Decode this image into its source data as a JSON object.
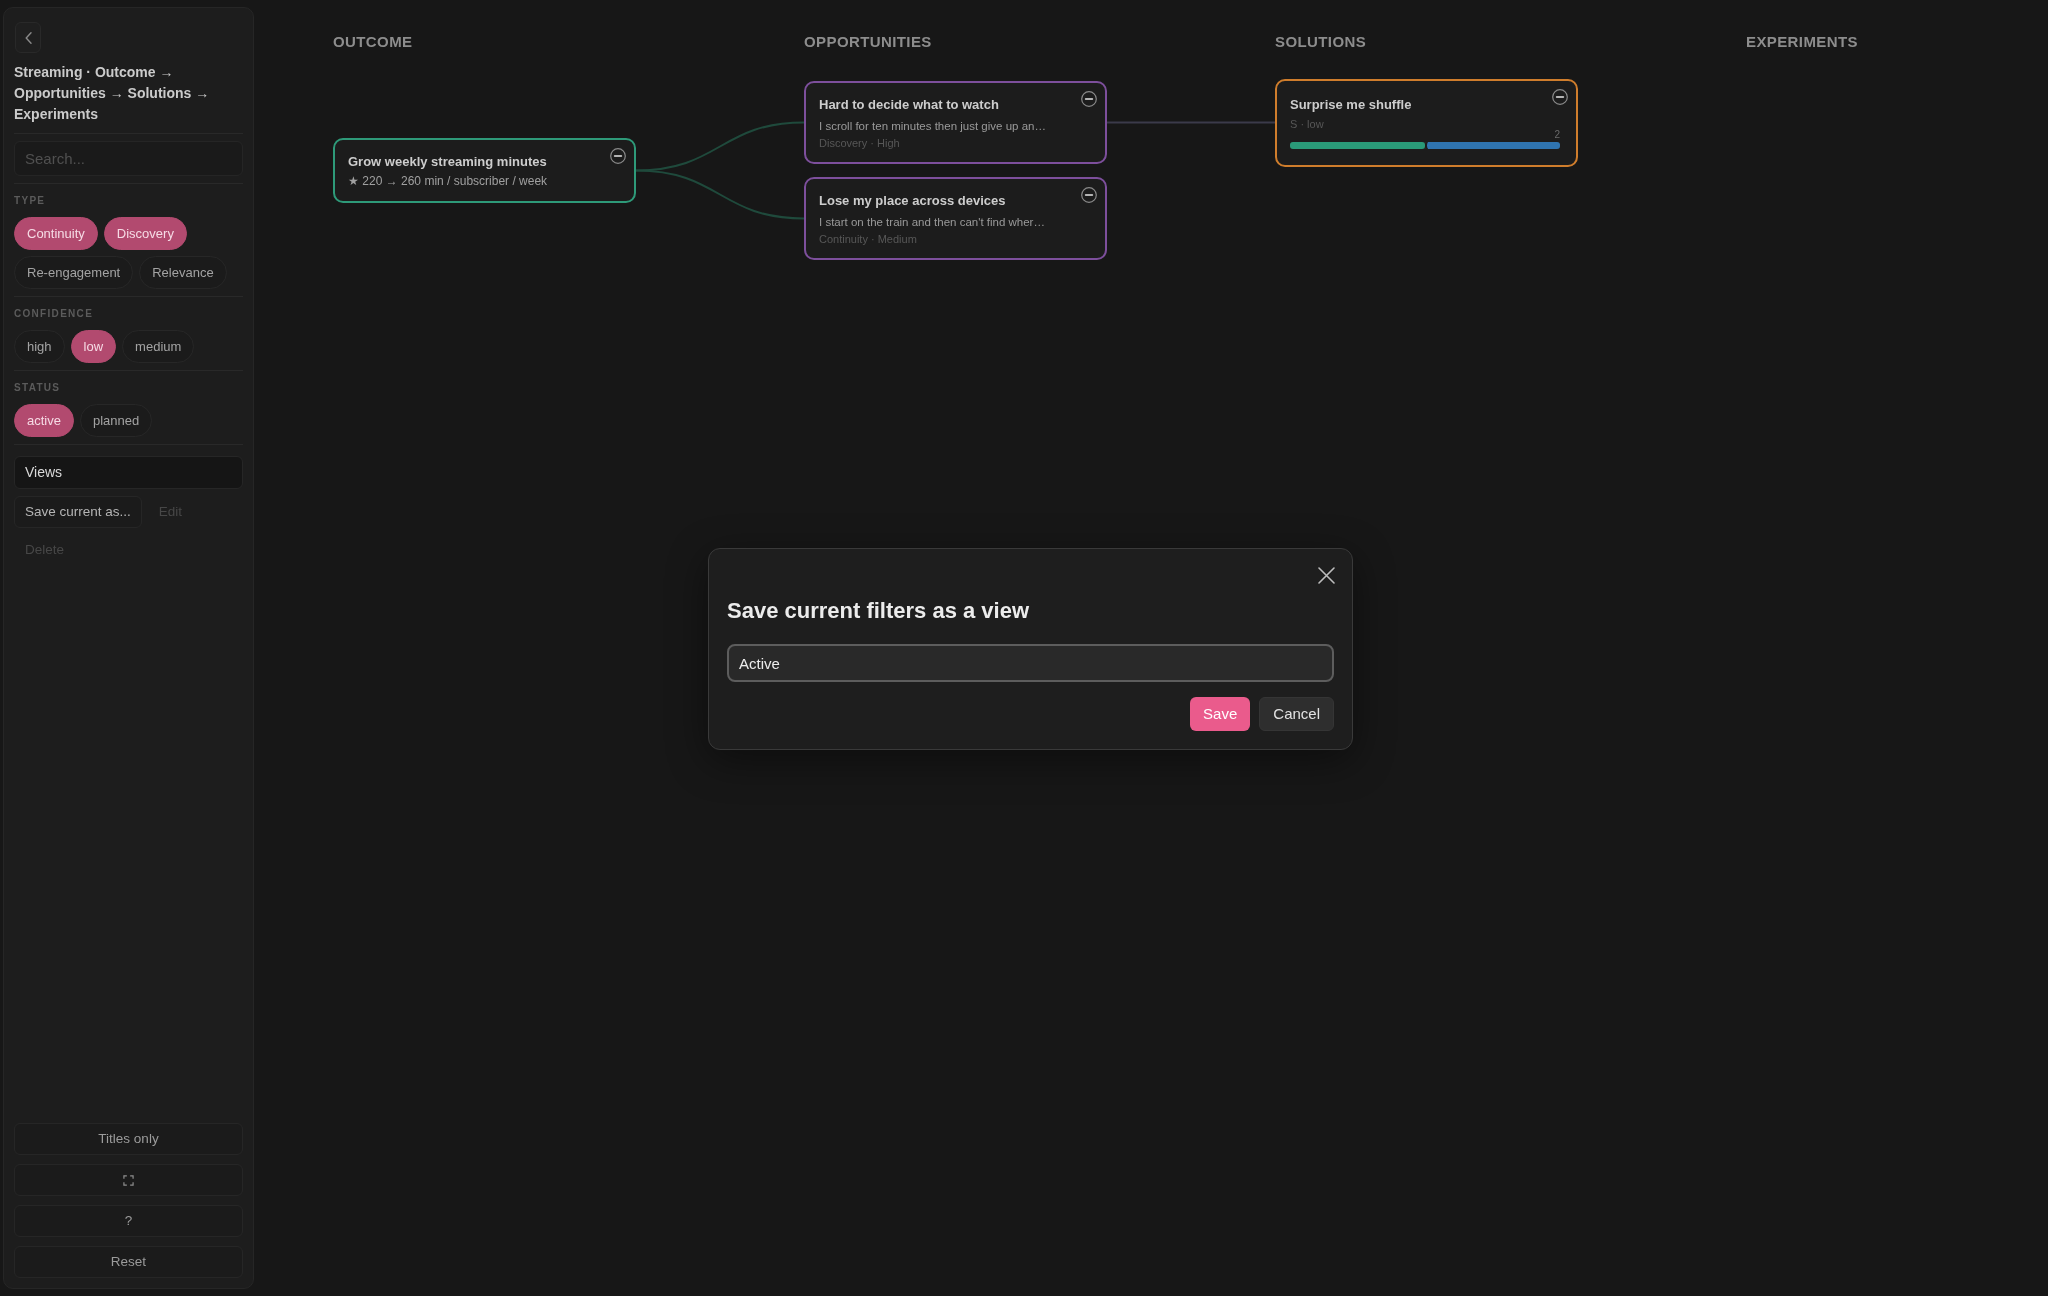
{
  "sidebar": {
    "title": "Streaming · Outcome → Opportunities → Solutions → Experiments",
    "search": {
      "placeholder": "Search..."
    },
    "filter_groups": [
      {
        "label": "TYPE",
        "chips": [
          {
            "label": "Continuity",
            "selected": true
          },
          {
            "label": "Discovery",
            "selected": true
          },
          {
            "label": "Re-engagement",
            "selected": false
          },
          {
            "label": "Relevance",
            "selected": false
          }
        ]
      },
      {
        "label": "CONFIDENCE",
        "chips": [
          {
            "label": "high",
            "selected": false
          },
          {
            "label": "low",
            "selected": true
          },
          {
            "label": "medium",
            "selected": false
          }
        ]
      },
      {
        "label": "STATUS",
        "chips": [
          {
            "label": "active",
            "selected": true
          },
          {
            "label": "planned",
            "selected": false
          }
        ]
      }
    ],
    "views": {
      "value": "Views"
    },
    "view_actions": [
      {
        "label": "Save current as...",
        "disabled": false
      },
      {
        "label": "Edit",
        "disabled": true
      },
      {
        "label": "Delete",
        "disabled": true
      }
    ],
    "footer_buttons": [
      {
        "kind": "text",
        "label": "Titles only"
      },
      {
        "kind": "icon"
      },
      {
        "kind": "text",
        "label": "?"
      },
      {
        "kind": "text",
        "label": "Reset"
      }
    ]
  },
  "columns": [
    {
      "heading": "OUTCOME"
    },
    {
      "heading": "OPPORTUNITIES"
    },
    {
      "heading": "SOLUTIONS"
    },
    {
      "heading": "EXPERIMENTS"
    }
  ],
  "tree": {
    "kind": "outcome",
    "title": "Grow weekly streaming minutes",
    "metric": "★ 220 → 260 min / subscriber / week",
    "expanded": true,
    "children": [
      {
        "kind": "opportunity",
        "title": "Hard to decide what to watch",
        "description": "I scroll for ten minutes then just give up an…",
        "meta": "Discovery · High",
        "expanded": true,
        "children": [
          {
            "kind": "solution",
            "title": "Surprise me shuffle",
            "meta": "S · low",
            "count": "2",
            "expanded": true,
            "progress": [
              {
                "color": "#2a9a78",
                "level": 0.5
              },
              {
                "color": "#2f74b0",
                "level": 0.5
              }
            ]
          }
        ]
      },
      {
        "kind": "opportunity",
        "title": "Lose my place across devices",
        "description": "I start on the train and then can't find wher…",
        "meta": "Continuity · Medium",
        "expanded": true
      }
    ]
  },
  "dialog": {
    "title": "Save current filters as a view",
    "input": {
      "value": "Active"
    },
    "buttons": [
      {
        "kind": "primary",
        "label": "Save"
      },
      {
        "kind": "secondary",
        "label": "Cancel"
      }
    ]
  }
}
